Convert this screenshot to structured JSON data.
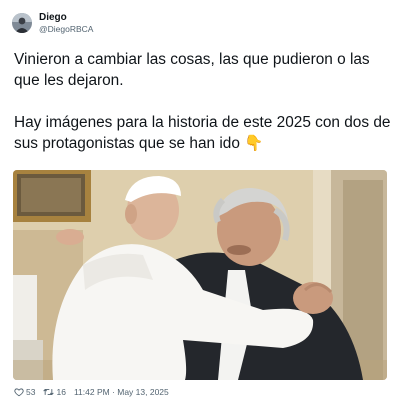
{
  "author": {
    "display_name": "Diego",
    "handle": "@DiegoRBCA"
  },
  "tweet": {
    "paragraph_1": "Vinieron a cambiar las cosas, las que pudieron o las que les dejaron.",
    "paragraph_2": "Hay imágenes para la historia de este 2025 con dos de sus protagonistas que se han ido 👇"
  },
  "media": {
    "icon": "photo"
  },
  "stats": {
    "likes": "53",
    "retweets": "16",
    "timestamp": "11:42 PM · May 13, 2025"
  },
  "colors": {
    "text": "#0f1419",
    "secondary_text": "#536471",
    "like_icon": "#536471",
    "retweet_icon": "#536471"
  }
}
